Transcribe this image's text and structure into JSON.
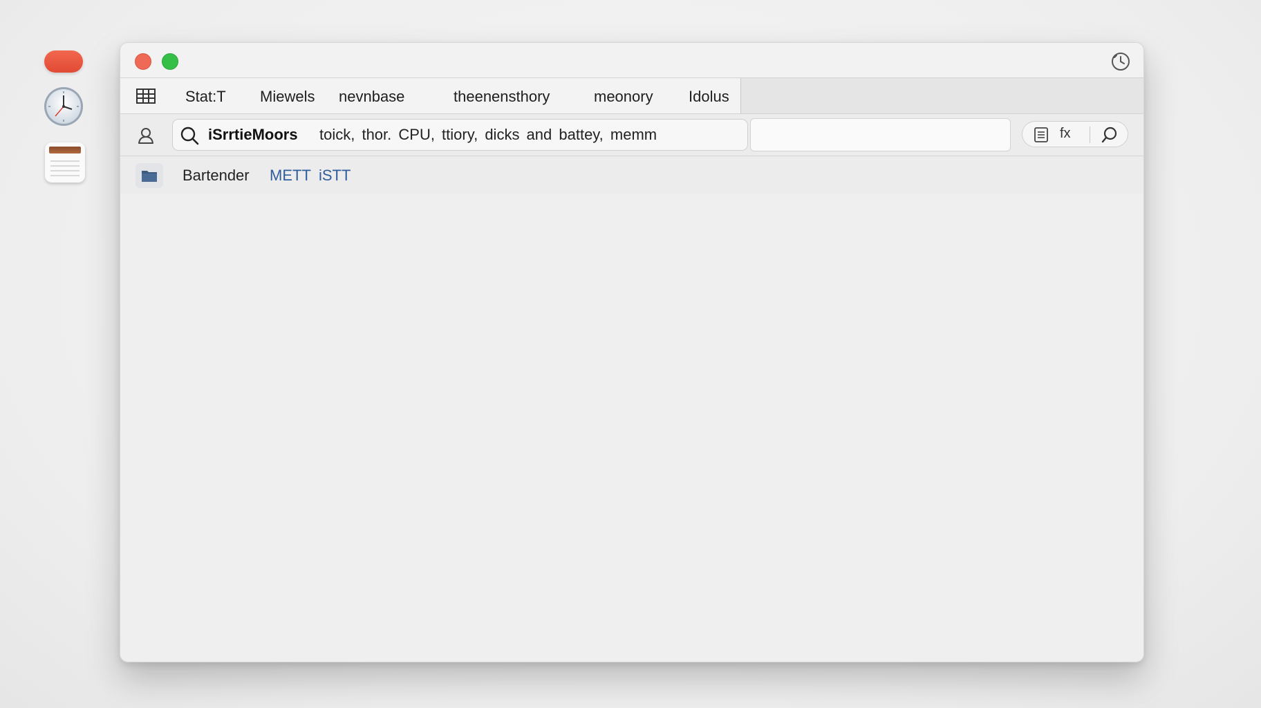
{
  "dock": {
    "items": [
      {
        "icon": "red-pill-app-icon",
        "color": "#e9533d"
      },
      {
        "icon": "clock-icon"
      },
      {
        "icon": "notes-icon"
      }
    ]
  },
  "window": {
    "traffic_lights": {
      "close_color": "#ee6a57",
      "zoom_color": "#36bf47"
    },
    "history_icon": "history-icon"
  },
  "tabbar": {
    "tabs": [
      {
        "label": "Stat:T"
      },
      {
        "label": "Miewels"
      },
      {
        "label": "nevnbase"
      },
      {
        "label": "theenensthory"
      },
      {
        "label": "meonory"
      },
      {
        "label": "Idolus"
      }
    ]
  },
  "toolbar": {
    "search": {
      "query_bold": "iSrrtieMoors",
      "query_rest": "toick, thor. CPU, ttiory, dicks and battey, memm"
    },
    "side_input": {
      "value": ""
    },
    "fx_label": "fx"
  },
  "results": [
    {
      "name": "Bartender",
      "tags": [
        "METT",
        "iSTT"
      ],
      "tag_color": "#2f5d9c"
    }
  ]
}
